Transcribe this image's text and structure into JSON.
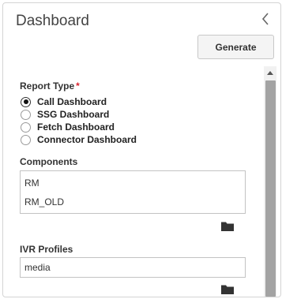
{
  "panel": {
    "title": "Dashboard",
    "collapse_icon": "chevron-left-icon"
  },
  "toolbar": {
    "generate_label": "Generate"
  },
  "report_type": {
    "label": "Report Type",
    "required_mark": "*",
    "required_color": "#d9232e",
    "options": [
      {
        "label": "Call Dashboard",
        "selected": true
      },
      {
        "label": "SSG Dashboard",
        "selected": false
      },
      {
        "label": "Fetch Dashboard",
        "selected": false
      },
      {
        "label": "Connector Dashboard",
        "selected": false
      }
    ]
  },
  "components": {
    "label": "Components",
    "items": [
      "RM",
      "RM_OLD"
    ],
    "browse_icon": "folder-icon"
  },
  "ivr_profiles": {
    "label": "IVR Profiles",
    "value": "media",
    "browse_icon": "folder-icon"
  }
}
